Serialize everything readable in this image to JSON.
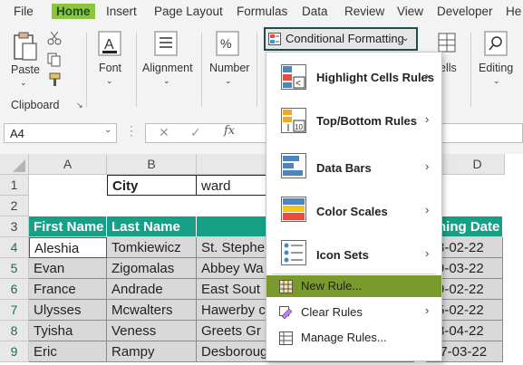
{
  "menu": {
    "tabs": [
      "File",
      "Home",
      "Insert",
      "Page Layout",
      "Formulas",
      "Data",
      "Review",
      "View",
      "Developer",
      "He"
    ],
    "active_tab": "Home"
  },
  "ribbon": {
    "paste_label": "Paste",
    "clipboard_label": "Clipboard",
    "font_label": "Font",
    "alignment_label": "Alignment",
    "number_label": "Number",
    "cells_label": "ells",
    "editing_label": "Editing",
    "cf_button_label": "Conditional Formatting"
  },
  "formula_bar": {
    "name_box": "A4",
    "fx": "fx"
  },
  "grid": {
    "columns": [
      "A",
      "B",
      "C",
      "D"
    ],
    "rows": [
      "1",
      "2",
      "3",
      "4",
      "5",
      "6",
      "7",
      "8",
      "9"
    ],
    "row1": {
      "b": "City",
      "c": "ward"
    },
    "headers": {
      "a": "First Name",
      "b": "Last Name",
      "d": "ning Date"
    },
    "data": [
      {
        "a": "Aleshia",
        "b": "Tomkiewicz",
        "c": "St. Stephe",
        "d": "8-02-22"
      },
      {
        "a": "Evan",
        "b": "Zigomalas",
        "c": "Abbey Wa",
        "d": "9-03-22"
      },
      {
        "a": "France",
        "b": "Andrade",
        "c": "East Sout",
        "d": "9-02-22"
      },
      {
        "a": "Ulysses",
        "b": "Mcwalters",
        "c": "Hawerby c",
        "d": "5-02-22"
      },
      {
        "a": "Tyisha",
        "b": "Veness",
        "c": "Greets Gr",
        "d": "8-04-22"
      },
      {
        "a": "Eric",
        "b": "Rampy",
        "c": "Desborough",
        "d": "27-03-22"
      }
    ]
  },
  "cf_menu": {
    "items": [
      {
        "label": "Highlight Cells Rules",
        "key": "H"
      },
      {
        "label": "Top/Bottom Rules",
        "key": "T"
      },
      {
        "label": "Data Bars",
        "key": "D"
      },
      {
        "label": "Color Scales",
        "key": "S"
      },
      {
        "label": "Icon Sets",
        "key": "I"
      }
    ],
    "new_rule": "New Rule...",
    "clear_rules": "Clear Rules",
    "manage_rules": "Manage Rules..."
  },
  "colors": {
    "accent_green": "#8cc63f",
    "teal": "#16a085",
    "hover": "#7a9a2e"
  }
}
